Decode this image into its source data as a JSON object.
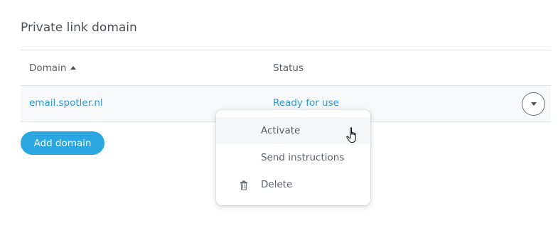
{
  "section": {
    "title": "Private link domain"
  },
  "table": {
    "columns": [
      {
        "label": "Domain",
        "sort": "ascending",
        "icon": "sort-up-icon"
      },
      {
        "label": "Status"
      }
    ],
    "rows": [
      {
        "domain": "email.spotler.nl",
        "status": "Ready for use",
        "menu_icon": "chevron-down-icon"
      }
    ]
  },
  "actions": {
    "add_domain_label": "Add domain"
  },
  "dropdown": {
    "items": [
      {
        "label": "Activate",
        "icon": "",
        "hovered": true
      },
      {
        "label": "Send instructions",
        "icon": ""
      },
      {
        "label": "Delete",
        "icon": "trash-icon"
      }
    ]
  },
  "colors": {
    "accent": "#2aa6e0",
    "link": "#2d9ad5",
    "text": "#4a4f55",
    "row_background": "#f7f8f9",
    "divider": "#dfe2e6"
  },
  "cursor": {
    "icon": "hand-pointer-icon"
  }
}
